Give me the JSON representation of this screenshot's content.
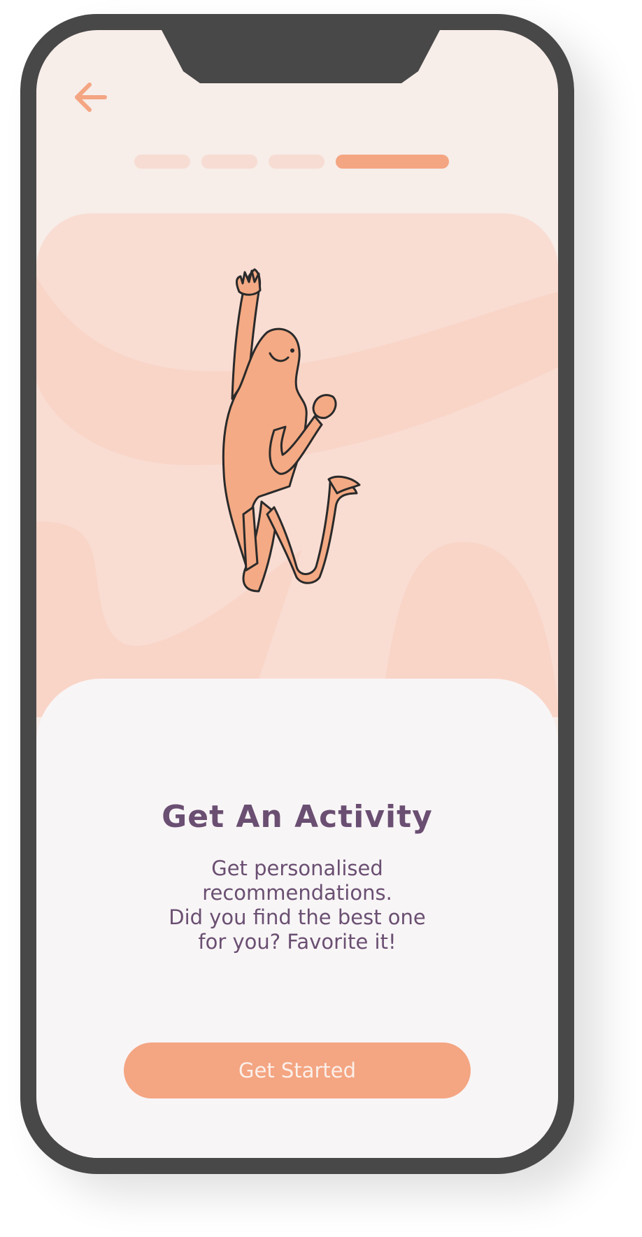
{
  "colors": {
    "accent": "#f4a582",
    "text": "#6a4f72",
    "screen_bg": "#f7ede9",
    "card_bg": "#f8f5f6",
    "hero_bg": "#f9ddd3",
    "phone_frame": "#484848"
  },
  "header": {
    "back_icon": "arrow-left-icon"
  },
  "onboarding": {
    "total_steps": 4,
    "current_step": 4
  },
  "hero": {
    "illustration": "jumping-figure-illustration"
  },
  "content": {
    "title": "Get An Activity",
    "description_lines": [
      "Get personalised",
      "recommendations.",
      "Did you find the best one",
      "for you? Favorite it!"
    ]
  },
  "cta": {
    "label": "Get Started"
  }
}
